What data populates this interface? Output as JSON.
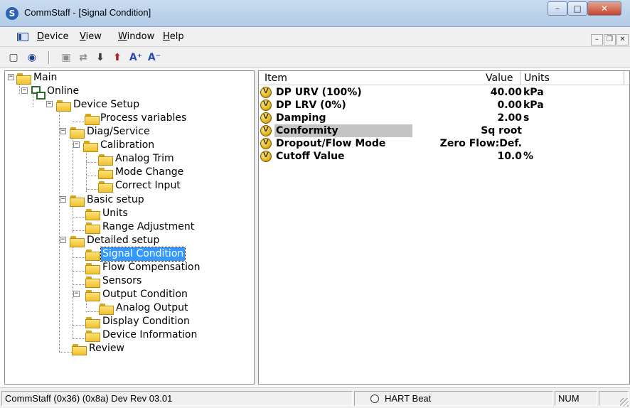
{
  "window": {
    "title": "CommStaff - [Signal Condition]",
    "minimize": "–",
    "maximize": "□",
    "close": "✕"
  },
  "menu": {
    "items": [
      {
        "underline": "D",
        "rest": "evice"
      },
      {
        "underline": "V",
        "rest": "iew"
      },
      {
        "underline": "W",
        "rest": "indow"
      },
      {
        "underline": "H",
        "rest": "elp"
      }
    ],
    "mdi_minimize": "–",
    "mdi_restore": "❐",
    "mdi_close": "✕"
  },
  "toolbar": {
    "icons": [
      "new-document-icon",
      "connect-icon",
      "device-icon",
      "transfer-icon",
      "download-icon",
      "upload-icon",
      "font-increase-icon",
      "font-decrease-icon"
    ],
    "font_increase": "A⁺",
    "font_decrease": "A⁻"
  },
  "tree": {
    "nodes": [
      {
        "id": "main",
        "label": "Main"
      },
      {
        "id": "online",
        "label": "Online"
      },
      {
        "id": "device-setup",
        "label": "Device Setup"
      },
      {
        "id": "process-variables",
        "label": "Process variables"
      },
      {
        "id": "diag-service",
        "label": "Diag/Service"
      },
      {
        "id": "calibration",
        "label": "Calibration"
      },
      {
        "id": "analog-trim",
        "label": "Analog Trim"
      },
      {
        "id": "mode-change",
        "label": "Mode Change"
      },
      {
        "id": "correct-input",
        "label": "Correct Input"
      },
      {
        "id": "basic-setup",
        "label": "Basic setup"
      },
      {
        "id": "units",
        "label": "Units"
      },
      {
        "id": "range-adjustment",
        "label": "Range Adjustment"
      },
      {
        "id": "detailed-setup",
        "label": "Detailed setup"
      },
      {
        "id": "signal-condition",
        "label": "Signal Condition",
        "selected": true
      },
      {
        "id": "flow-compensation",
        "label": "Flow Compensation"
      },
      {
        "id": "sensors",
        "label": "Sensors"
      },
      {
        "id": "output-condition",
        "label": "Output Condition"
      },
      {
        "id": "analog-output",
        "label": "Analog Output"
      },
      {
        "id": "display-condition",
        "label": "Display Condition"
      },
      {
        "id": "device-information",
        "label": "Device Information"
      },
      {
        "id": "review",
        "label": "Review"
      }
    ]
  },
  "list": {
    "columns": {
      "item": "Item",
      "value": "Value",
      "units": "Units"
    },
    "rows": [
      {
        "item": "DP URV (100%)",
        "value": "40.00",
        "units": "kPa"
      },
      {
        "item": "DP LRV (0%)",
        "value": "0.00",
        "units": "kPa"
      },
      {
        "item": "Damping",
        "value": "2.00",
        "units": "s"
      },
      {
        "item": "Conformity",
        "value": "Sq root",
        "units": "",
        "highlighted": true
      },
      {
        "item": "Dropout/Flow Mode",
        "value": "Zero Flow:Def.",
        "units": ""
      },
      {
        "item": "Cutoff Value",
        "value": "10.0",
        "units": "%"
      }
    ]
  },
  "status": {
    "device": "CommStaff  (0x36)  (0x8a) Dev Rev 03.01",
    "hart": "HART Beat",
    "num": "NUM"
  }
}
